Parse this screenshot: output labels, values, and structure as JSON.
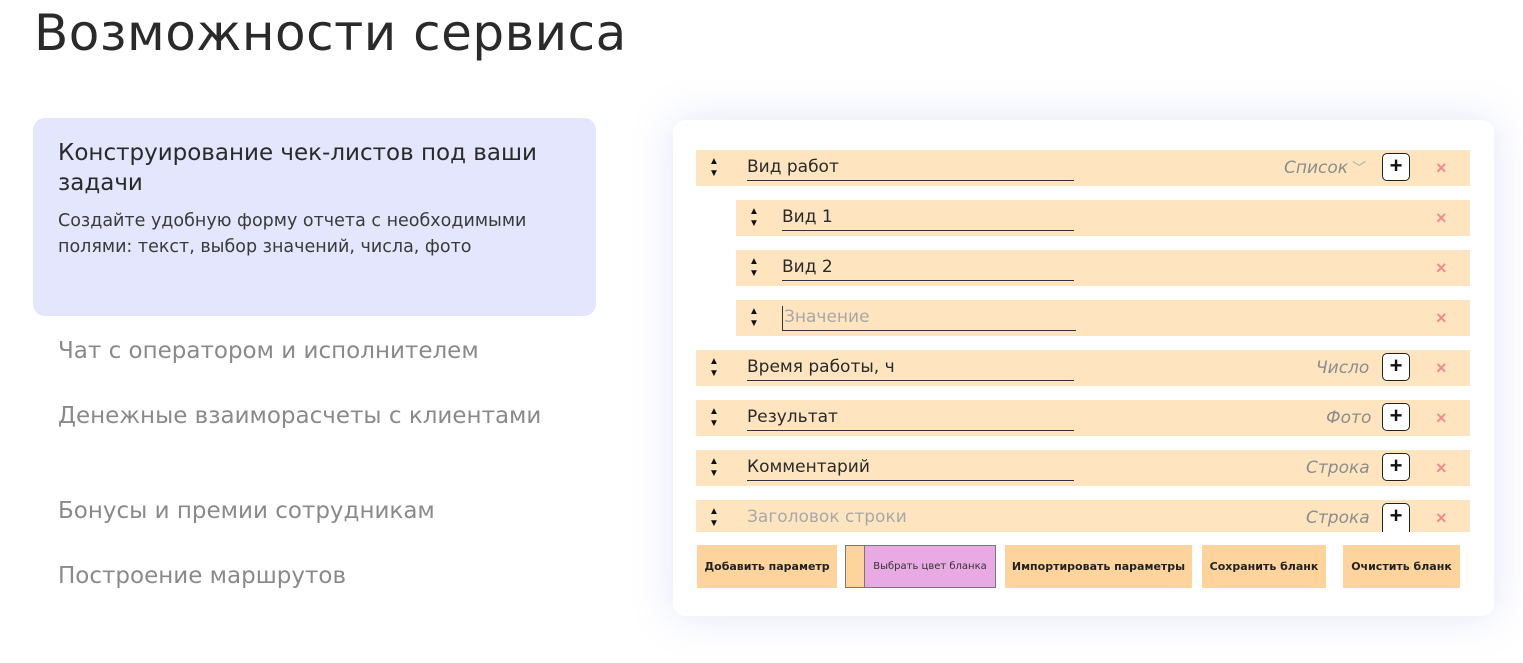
{
  "page": {
    "title": "Возможности сервиса"
  },
  "features": {
    "active": {
      "title": "Конструирование чек-листов под ваши задачи",
      "description": "Создайте удобную форму отчета с необходимыми полями: текст, выбор значений, числа, фото"
    },
    "items": [
      "Чат с оператором и исполнителем",
      "Денежные взаиморасчеты с клиентами",
      "Бонусы и премии сотрудникам",
      "Построение маршрутов"
    ]
  },
  "form": {
    "rows": [
      {
        "name": "Вид работ",
        "type": "Список"
      },
      {
        "name": "Вид 1"
      },
      {
        "name": "Вид 2"
      },
      {
        "placeholder": "Значение"
      },
      {
        "name": "Время работы, ч",
        "type": "Число"
      },
      {
        "name": "Результат",
        "type": "Фото"
      },
      {
        "name": "Комментарий",
        "type": "Строка"
      },
      {
        "placeholder": "Заголовок строки",
        "type": "Строка"
      }
    ],
    "icons": {
      "sort": "sort-arrows-icon",
      "add": "plus-icon",
      "remove": "close-icon",
      "dropdown": "chevron-down-icon",
      "sort_glyph": "▲▼",
      "plus_glyph": "+",
      "close_glyph": "×",
      "chevron_glyph": "﹀"
    },
    "buttons": {
      "add_param": "Добавить параметр",
      "choose_color": "Выбрать цвет бланка",
      "import_params": "Импортировать параметры",
      "save_form": "Сохранить бланк",
      "clear_form": "Очистить бланк"
    }
  },
  "colors": {
    "row_bg": "#fee5bf",
    "button_bg": "#fed49c",
    "active_feature_bg": "#e3e6fc",
    "color_picker": "#e9a9e3",
    "remove": "#f28b8b"
  }
}
